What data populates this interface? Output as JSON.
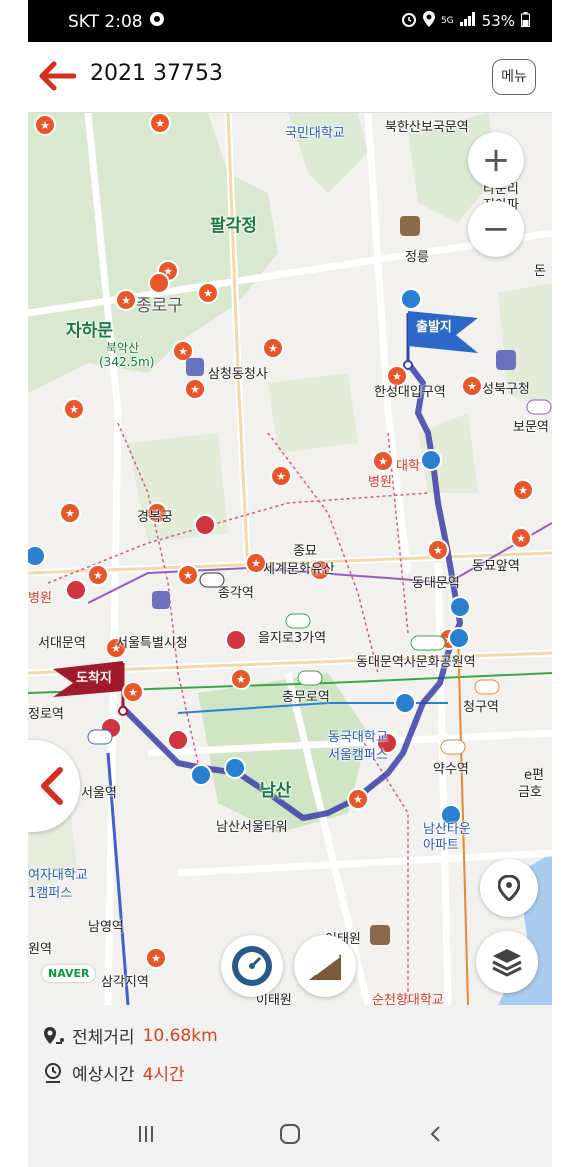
{
  "status_bar": {
    "carrier_time": "SKT 2:08",
    "signal_tag": "5G",
    "battery": "53%"
  },
  "header": {
    "title": "2021 37753",
    "menu_label": "메뉴"
  },
  "map": {
    "labels": {
      "kookmin": "국민대학교",
      "bukhansan_gate": "북한산보국문역",
      "palgakjeong": "팔각정",
      "jeongneung": "정릉",
      "town": "타운리",
      "jiapat": "지아파",
      "jongno": "종로구",
      "jahamun": "자하문",
      "bugaksan": "북악산",
      "elevation": "(342.5m)",
      "samcheong": "삼청동청사",
      "hansung": "한성대입구역",
      "seongbuk": "성북구청",
      "bomun": "보문역",
      "univ": "대학",
      "hospital": "병원",
      "gyeongbokgung": "경복궁",
      "jongmyo": "종묘",
      "world_heritage": "세계문화유산",
      "jonggak": "종각역",
      "dongdaemun": "동대문역",
      "dongmyo": "동묘앞역",
      "seodaemun": "서대문역",
      "cityhall": "서울특별시청",
      "euljiro": "을지로3가역",
      "ddp": "동대문역사문화공원역",
      "chungmuro": "충무로역",
      "cheonggu": "청구역",
      "jeongro": "정로역",
      "seoul_station": "서울역",
      "dongguk": "동국대학교",
      "dongguk_campus": "서울캠퍼스",
      "yaksu": "약수역",
      "namsan": "남산",
      "namsan_tower": "남산서울타워",
      "namsan_town": "남산타운",
      "apartment": "아파트",
      "womens_univ": "여자대학교",
      "campus1": "1캠퍼스",
      "namyeong": "남영역",
      "won_station": "원역",
      "samgakji": "삼각지역",
      "itaewon": "이태원",
      "itaewon2": "이태원",
      "hospital2": "순천향대학교",
      "station_e": "e편",
      "geumho": "금호",
      "seobyeongwon": "병원",
      "don": "돈"
    },
    "flags": {
      "start": "출발지",
      "end": "도착지"
    },
    "brand": "NAVER",
    "route_color": "#3b3fa8",
    "accent_color": "#e8572a"
  },
  "summary": {
    "distance_label": "전체거리",
    "distance_value": "10.68km",
    "time_label": "예상시간",
    "time_value": "4시간"
  }
}
